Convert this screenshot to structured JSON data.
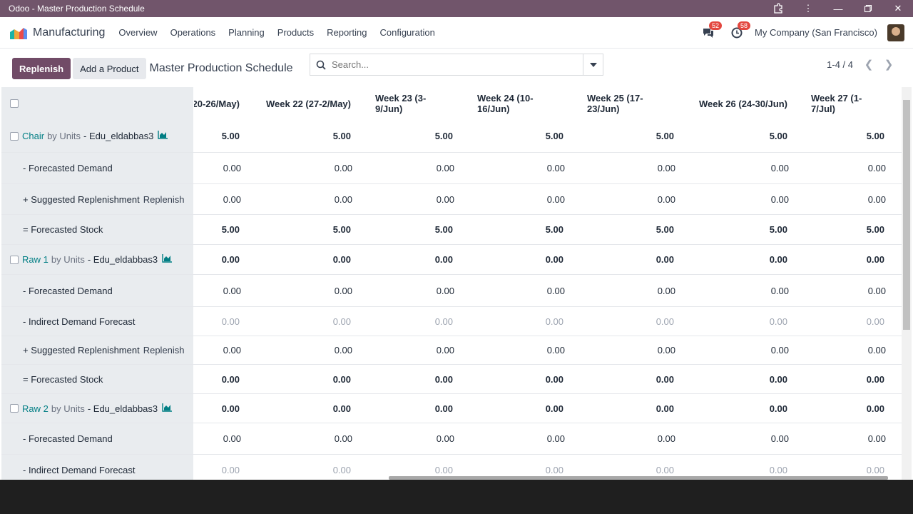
{
  "window": {
    "title": "Odoo - Master Production Schedule"
  },
  "navbar": {
    "app_name": "Manufacturing",
    "menu": [
      "Overview",
      "Operations",
      "Planning",
      "Products",
      "Reporting",
      "Configuration"
    ],
    "messages_count": "52",
    "activities_count": "58",
    "company": "My Company (San Francisco)"
  },
  "control": {
    "replenish_label": "Replenish",
    "add_product_label": "Add a Product",
    "breadcrumb": "Master Production Schedule",
    "search_placeholder": "Search...",
    "pager": "1-4 / 4"
  },
  "columns": [
    "20-26/May)",
    "Week 22 (27-2/May)",
    "Week 23 (3-9/Jun)",
    "Week 24 (10-16/Jun)",
    "Week 25 (17-23/Jun)",
    "Week 26 (24-30/Jun)",
    "Week 27 (1-7/Jul)"
  ],
  "rows": [
    {
      "kind": "product",
      "name": "Chair",
      "uom": "by Units",
      "warehouse": "- Edu_eldabbas3",
      "values": [
        "5.00",
        "5.00",
        "5.00",
        "5.00",
        "5.00",
        "5.00",
        "5.00"
      ]
    },
    {
      "kind": "input",
      "label": "- Forecasted Demand",
      "values": [
        "0.00",
        "0.00",
        "0.00",
        "0.00",
        "0.00",
        "0.00",
        "0.00"
      ]
    },
    {
      "kind": "input",
      "label": "+ Suggested Replenishment",
      "action": "Replenish",
      "values": [
        "0.00",
        "0.00",
        "0.00",
        "0.00",
        "0.00",
        "0.00",
        "0.00"
      ]
    },
    {
      "kind": "bold",
      "label": "= Forecasted Stock",
      "values": [
        "5.00",
        "5.00",
        "5.00",
        "5.00",
        "5.00",
        "5.00",
        "5.00"
      ]
    },
    {
      "kind": "product",
      "name": "Raw 1",
      "uom": "by Units",
      "warehouse": "- Edu_eldabbas3",
      "values": [
        "0.00",
        "0.00",
        "0.00",
        "0.00",
        "0.00",
        "0.00",
        "0.00"
      ]
    },
    {
      "kind": "input",
      "label": "- Forecasted Demand",
      "values": [
        "0.00",
        "0.00",
        "0.00",
        "0.00",
        "0.00",
        "0.00",
        "0.00"
      ]
    },
    {
      "kind": "gray",
      "label": "- Indirect Demand Forecast",
      "values": [
        "0.00",
        "0.00",
        "0.00",
        "0.00",
        "0.00",
        "0.00",
        "0.00"
      ]
    },
    {
      "kind": "input",
      "label": "+ Suggested Replenishment",
      "action": "Replenish",
      "values": [
        "0.00",
        "0.00",
        "0.00",
        "0.00",
        "0.00",
        "0.00",
        "0.00"
      ]
    },
    {
      "kind": "bold",
      "label": "= Forecasted Stock",
      "values": [
        "0.00",
        "0.00",
        "0.00",
        "0.00",
        "0.00",
        "0.00",
        "0.00"
      ]
    },
    {
      "kind": "product",
      "name": "Raw 2",
      "uom": "by Units",
      "warehouse": "- Edu_eldabbas3",
      "values": [
        "0.00",
        "0.00",
        "0.00",
        "0.00",
        "0.00",
        "0.00",
        "0.00"
      ]
    },
    {
      "kind": "input",
      "label": "- Forecasted Demand",
      "values": [
        "0.00",
        "0.00",
        "0.00",
        "0.00",
        "0.00",
        "0.00",
        "0.00"
      ]
    },
    {
      "kind": "gray",
      "label": "- Indirect Demand Forecast",
      "values": [
        "0.00",
        "0.00",
        "0.00",
        "0.00",
        "0.00",
        "0.00",
        "0.00"
      ]
    }
  ]
}
